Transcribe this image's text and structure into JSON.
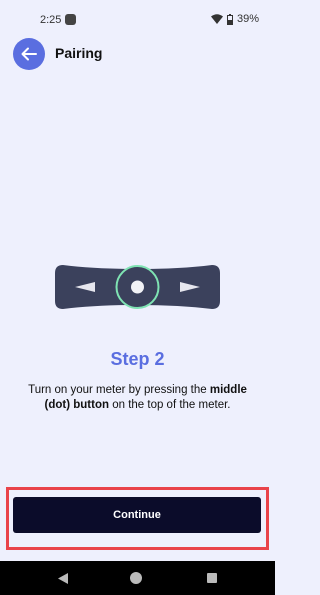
{
  "status": {
    "time": "2:25",
    "battery": "39%"
  },
  "header": {
    "title": "Pairing"
  },
  "step": {
    "title": "Step 2",
    "instruction_pre": "Turn on your meter by pressing the ",
    "instruction_bold": "middle (dot) button",
    "instruction_post": " on the top of the meter."
  },
  "actions": {
    "continue_label": "Continue"
  },
  "colors": {
    "accent": "#5a6ee0",
    "button_bg": "#0b0c2a",
    "highlight": "#e9434a",
    "meter_body": "#3b415c",
    "meter_ring": "#7fe3b3"
  },
  "icons": [
    "back-arrow-icon",
    "wifi-icon",
    "battery-icon",
    "meter-left-arrow-icon",
    "meter-right-arrow-icon",
    "meter-dot-button-icon"
  ]
}
